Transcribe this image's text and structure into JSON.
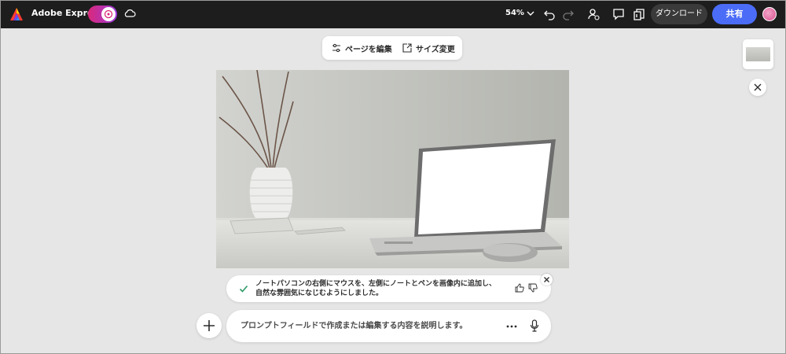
{
  "app": {
    "name": "Adobe Express"
  },
  "colors": {
    "topbar": "#1d1d1d",
    "accent": "#4a6cf7",
    "toggle": "#d9287a",
    "canvas_bg": "#e6e6e6"
  },
  "header": {
    "zoom": "54%",
    "download_label": "ダウンロード",
    "share_label": "共有",
    "icons": [
      "magic-icon",
      "cloud-icon",
      "chevron-down-icon",
      "undo-icon",
      "redo-icon",
      "person-icon",
      "comment-icon",
      "pages-icon"
    ]
  },
  "page_toolbar": {
    "edit_page": "ページを編集",
    "resize": "サイズ変更"
  },
  "result": {
    "line1": "ノートパソコンの右側にマウスを、左側にノートとペンを画像内に追加し、",
    "line2": "自然な雰囲気になじむようにしました。"
  },
  "prompt": {
    "placeholder": "プロンプトフィールドで作成または編集する内容を説明します。",
    "value": ""
  }
}
